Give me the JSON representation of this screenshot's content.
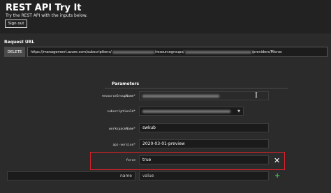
{
  "header": {
    "title": "REST API Try It",
    "subtitle": "Try the REST API with the inputs below.",
    "sign_out": "Sign out"
  },
  "request": {
    "label": "Request URL",
    "delete_label": "DELETE",
    "url_prefix": "https://management.azure.com/subscriptions/",
    "url_mid": "/resourcegroups/",
    "url_suffix": "/providers/Micros"
  },
  "params": {
    "title": "Parameters",
    "items": [
      {
        "label": "resourceGroupName*",
        "value": ""
      },
      {
        "label": "subscriptionId*",
        "value": ""
      },
      {
        "label": "workspaceName*",
        "value": "swkub"
      },
      {
        "label": "api-version*",
        "value": "2020-03-01-preview"
      },
      {
        "label": "force",
        "value": "true"
      }
    ],
    "new_name_placeholder": "name",
    "new_value_placeholder": "value"
  },
  "icons": {
    "close": "close-icon",
    "add": "plus-icon",
    "cursor": "text-cursor-icon",
    "chevron": "chevron-down-icon"
  },
  "colors": {
    "highlight": "#d8222a",
    "add": "#3cc34a"
  }
}
